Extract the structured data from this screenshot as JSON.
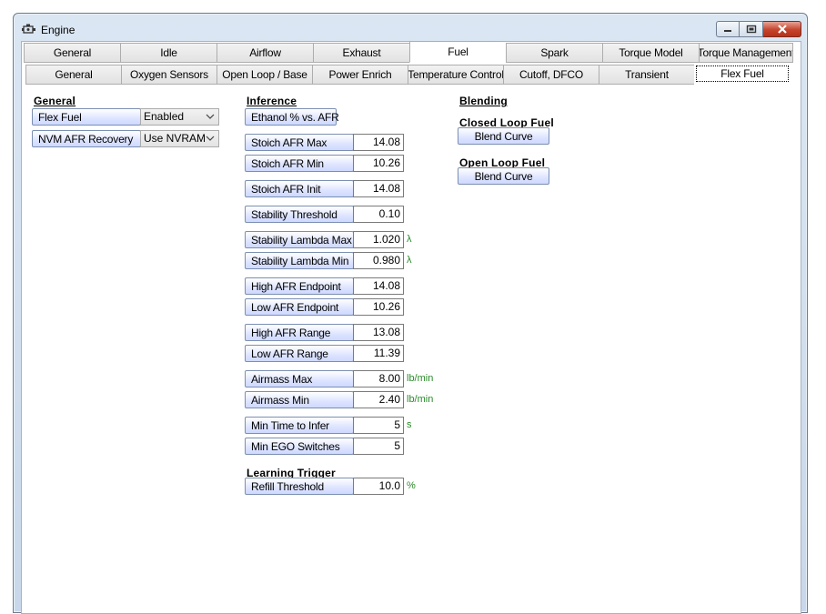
{
  "window": {
    "title": "Engine"
  },
  "main_tabs": [
    "General",
    "Idle",
    "Airflow",
    "Exhaust",
    "Fuel",
    "Spark",
    "Torque Model",
    "Torque Management"
  ],
  "sub_tabs": [
    "General",
    "Oxygen Sensors",
    "Open Loop / Base",
    "Power Enrich",
    "Temperature Control",
    "Cutoff, DFCO",
    "Transient",
    "Flex Fuel"
  ],
  "general": {
    "heading": "General",
    "rows": [
      {
        "label": "Flex Fuel",
        "value": "Enabled"
      },
      {
        "label": "NVM AFR Recovery",
        "value": "Use NVRAM"
      }
    ]
  },
  "inference": {
    "heading": "Inference",
    "table_button": "Ethanol % vs. AFR",
    "params": [
      {
        "label": "Stoich AFR Max",
        "value": "14.08",
        "unit": ""
      },
      {
        "label": "Stoich AFR Min",
        "value": "10.26",
        "unit": ""
      },
      {
        "label": "Stoich AFR Init",
        "value": "14.08",
        "unit": ""
      },
      {
        "label": "Stability Threshold",
        "value": "0.10",
        "unit": ""
      },
      {
        "label": "Stability Lambda Max",
        "value": "1.020",
        "unit": "λ"
      },
      {
        "label": "Stability Lambda Min",
        "value": "0.980",
        "unit": "λ"
      },
      {
        "label": "High AFR Endpoint",
        "value": "14.08",
        "unit": ""
      },
      {
        "label": "Low AFR Endpoint",
        "value": "10.26",
        "unit": ""
      },
      {
        "label": "High AFR Range",
        "value": "13.08",
        "unit": ""
      },
      {
        "label": "Low AFR Range",
        "value": "11.39",
        "unit": ""
      },
      {
        "label": "Airmass Max",
        "value": "8.00",
        "unit": "lb/min"
      },
      {
        "label": "Airmass Min",
        "value": "2.40",
        "unit": "lb/min"
      },
      {
        "label": "Min Time to Infer",
        "value": "5",
        "unit": "s"
      },
      {
        "label": "Min EGO Switches",
        "value": "5",
        "unit": ""
      }
    ],
    "learning_trigger": {
      "heading": "Learning Trigger",
      "label": "Refill Threshold",
      "value": "10.0",
      "unit": "%"
    }
  },
  "blending": {
    "heading": "Blending",
    "closed_loop": {
      "heading": "Closed Loop Fuel",
      "button": "Blend Curve"
    },
    "open_loop": {
      "heading": "Open Loop Fuel",
      "button": "Blend Curve"
    }
  }
}
